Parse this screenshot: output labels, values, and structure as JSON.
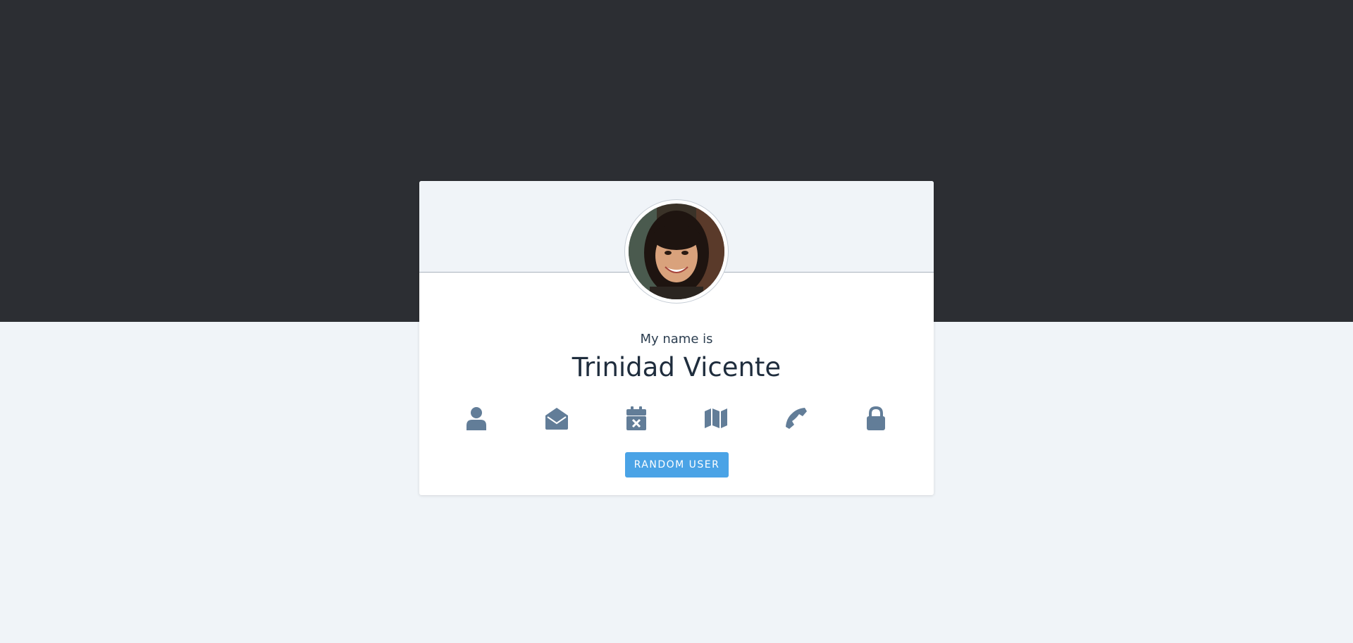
{
  "card": {
    "label": "My name is",
    "value": "Trinidad Vicente"
  },
  "icons": [
    "user-icon",
    "envelope-open-icon",
    "calendar-x-icon",
    "map-icon",
    "phone-icon",
    "lock-icon"
  ],
  "button": {
    "label": "RANDOM USER"
  },
  "colors": {
    "top_band": "#2c2e33",
    "page_bg": "#f0f4f8",
    "icon": "#627d98",
    "button": "#4aa3e6",
    "text": "#1f2d3d"
  }
}
